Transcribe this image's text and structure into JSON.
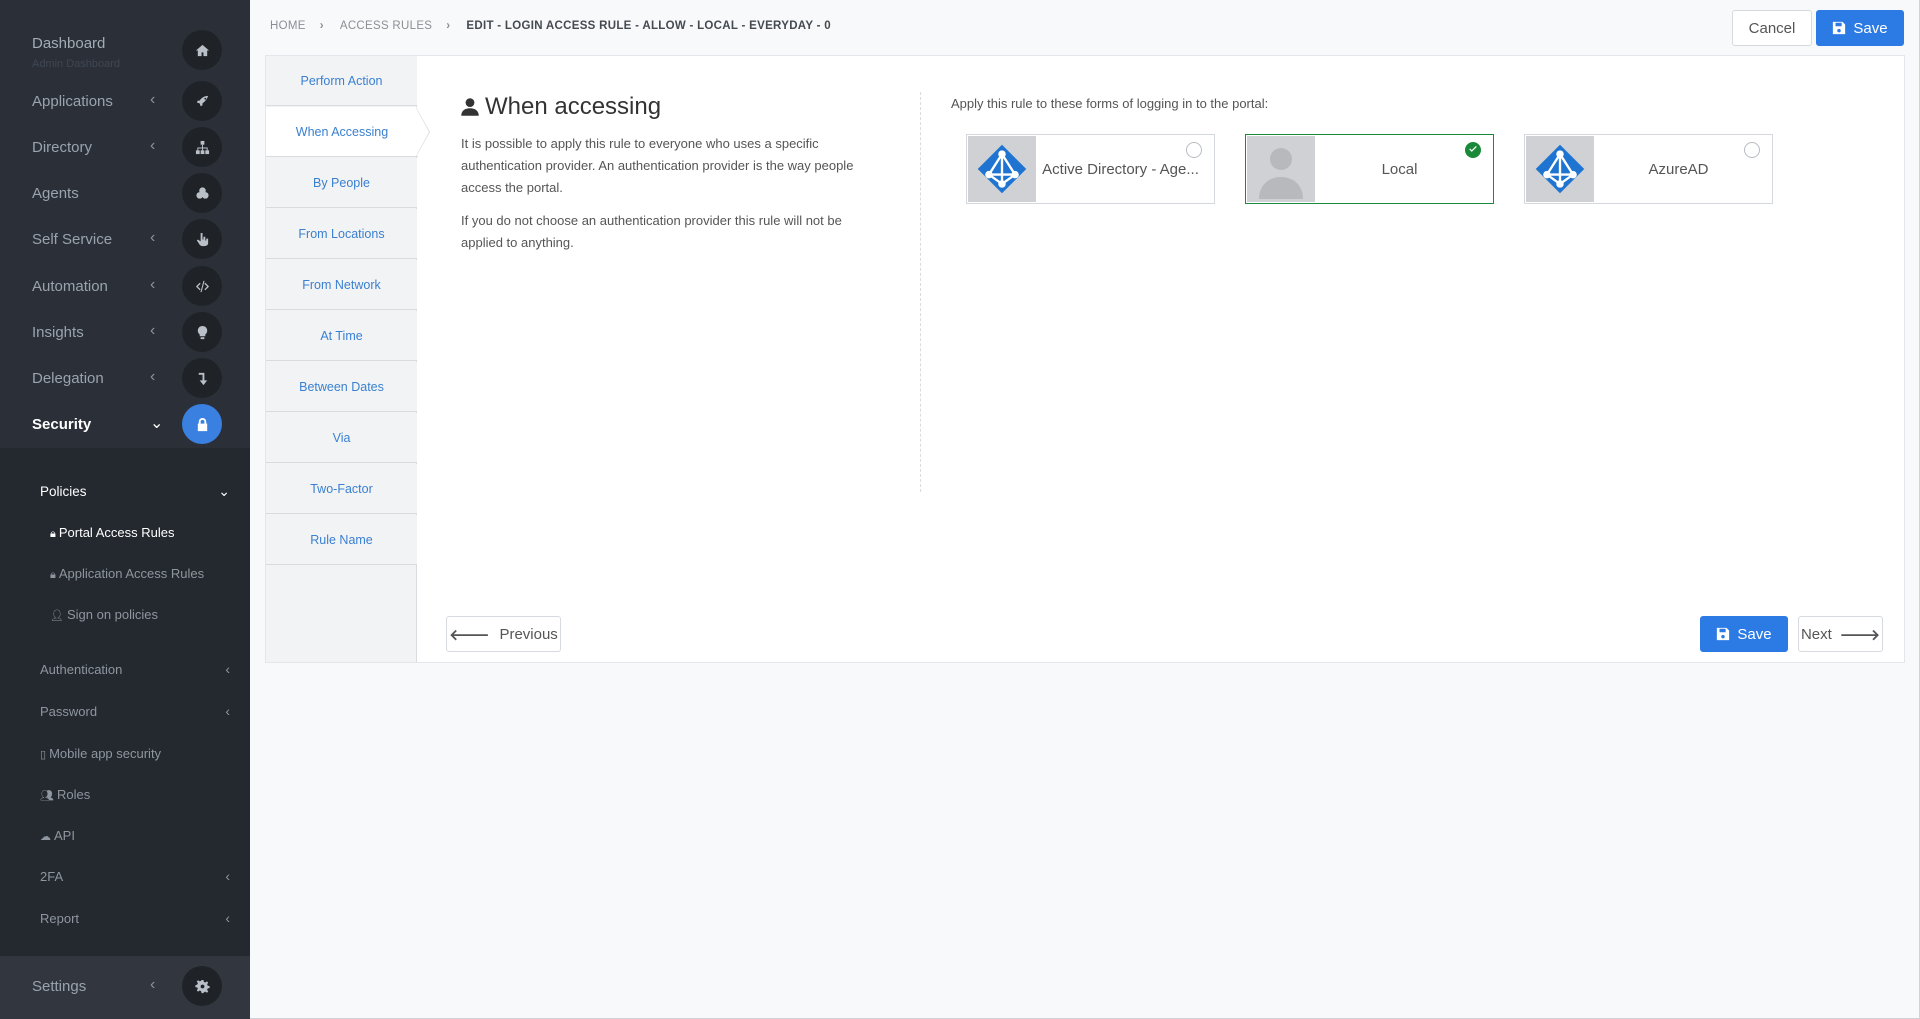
{
  "sidebar": {
    "dashboard": {
      "label": "Dashboard",
      "sub": "Admin Dashboard",
      "icon": "home-icon"
    },
    "items": [
      {
        "label": "Applications",
        "icon": "rocket-icon"
      },
      {
        "label": "Directory",
        "icon": "sitemap-icon"
      },
      {
        "label": "Agents",
        "icon": "cogs-icon"
      },
      {
        "label": "Self Service",
        "icon": "hand-pointer-icon"
      },
      {
        "label": "Automation",
        "icon": "code-icon"
      },
      {
        "label": "Insights",
        "icon": "lightbulb-icon"
      },
      {
        "label": "Delegation",
        "icon": "level-down-icon"
      },
      {
        "label": "Security",
        "icon": "lock-icon"
      }
    ],
    "security_sub": {
      "policies": "Policies",
      "portal_access_rules": "Portal Access Rules",
      "application_access_rules": "Application Access Rules",
      "sign_on_policies": "Sign on policies",
      "authentication": "Authentication",
      "password": "Password",
      "mobile_app_security": "Mobile app security",
      "roles": "Roles",
      "api": "API",
      "twofa": "2FA",
      "report": "Report"
    },
    "settings": {
      "label": "Settings",
      "icon": "gear-icon"
    }
  },
  "breadcrumb": {
    "home": "HOME",
    "access_rules": "ACCESS RULES",
    "current": "EDIT - LOGIN ACCESS RULE - ALLOW - LOCAL - EVERYDAY - 0"
  },
  "toolbar": {
    "cancel": "Cancel",
    "save": "Save"
  },
  "steps": [
    "Perform Action",
    "When Accessing",
    "By People",
    "From Locations",
    "From Network",
    "At Time",
    "Between Dates",
    "Via",
    "Two-Factor",
    "Rule Name"
  ],
  "content": {
    "title": "When accessing",
    "desc1": "It is possible to apply this rule to everyone who uses a specific authentication provider. An authentication provider is the way people access the portal.",
    "desc2": "If you do not choose an authentication provider this rule will not be applied to anything.",
    "apply_text": "Apply this rule to these forms of logging in to the portal:"
  },
  "providers": [
    {
      "name": "Active Directory - Age...",
      "icon": "azure-ad-icon",
      "selected": false
    },
    {
      "name": "Local",
      "icon": "user-silhouette-icon",
      "selected": true
    },
    {
      "name": "AzureAD",
      "icon": "azure-ad-icon",
      "selected": false
    }
  ],
  "footer": {
    "previous": "Previous",
    "save": "Save",
    "next": "Next"
  },
  "colors": {
    "accent": "#2c7be5",
    "selected": "#1a8a3a",
    "sidebar": "#2b3038"
  }
}
